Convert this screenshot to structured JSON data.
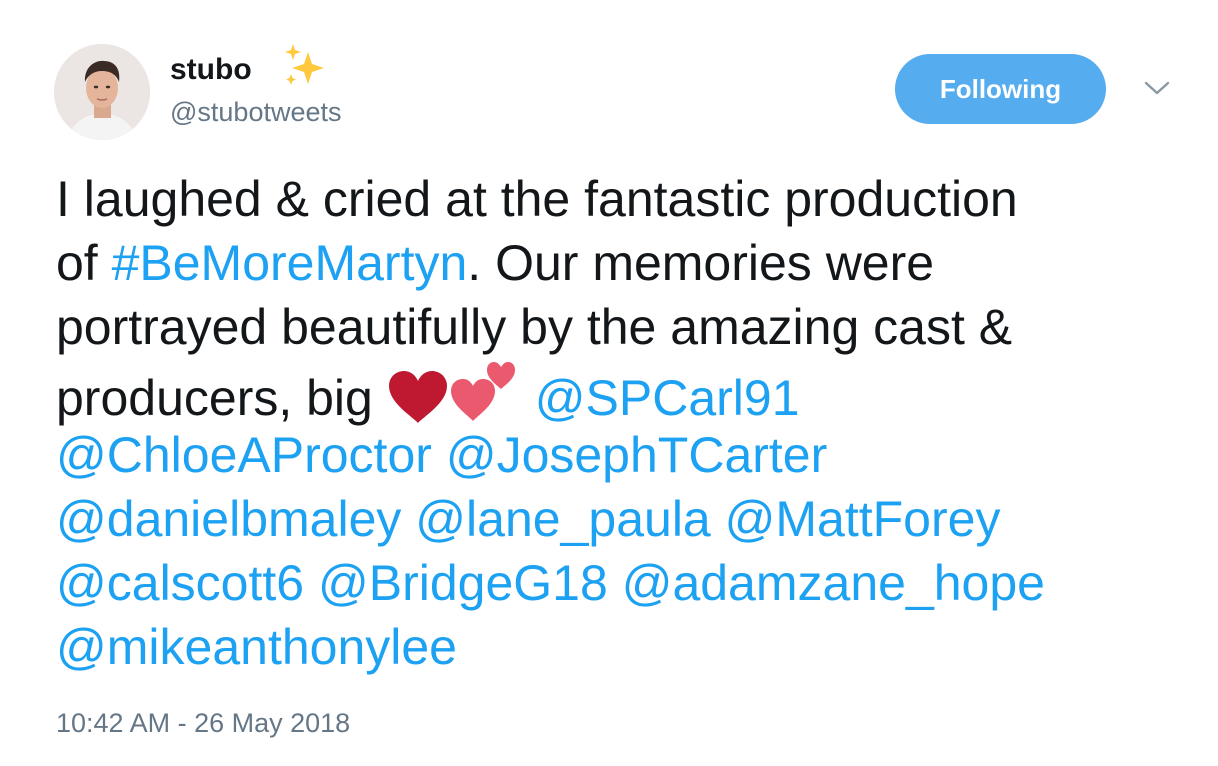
{
  "user": {
    "display_name": "stubo",
    "handle": "@stubotweets"
  },
  "header": {
    "follow_button_label": "Following"
  },
  "tweet": {
    "line1": "I laughed & cried at the fantastic production",
    "line2_pre": "of ",
    "hashtag": "#BeMoreMartyn",
    "line2_post": ". Our memories were",
    "line3": "portrayed beautifully by the amazing cast &",
    "line4_pre": "producers, big ",
    "mentions": [
      "@SPCarl91",
      "@ChloeAProctor",
      "@JosephTCarter",
      "@danielbmaley",
      "@lane_paula",
      "@MattForey",
      "@calscott6",
      "@BridgeG18",
      "@adamzane_hope",
      "@mikeanthonylee"
    ],
    "emojis": [
      "red-heart-icon",
      "two-hearts-icon"
    ]
  },
  "timestamp": "10:42 AM - 26 May 2018",
  "colors": {
    "link": "#1da1f2",
    "button": "#55acee",
    "secondary_text": "#657786",
    "text": "#14171a"
  }
}
